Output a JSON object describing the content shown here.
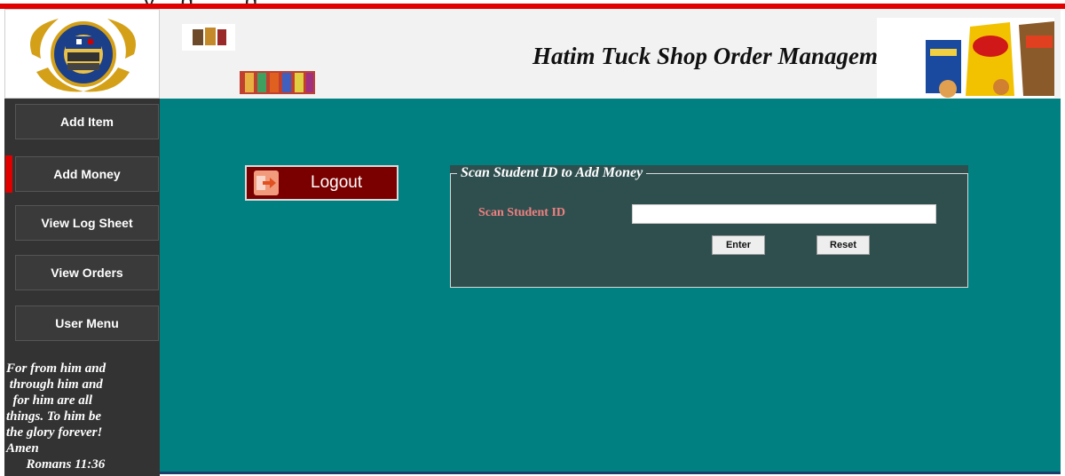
{
  "header": {
    "title": "Hatim Tuck Shop Order Management",
    "top_partial_text": "...y  ...g ... ...g ..."
  },
  "sidebar": {
    "items": [
      {
        "label": "Add Item"
      },
      {
        "label": "Add Money"
      },
      {
        "label": "View Log Sheet"
      },
      {
        "label": "View Orders"
      },
      {
        "label": "User Menu"
      }
    ],
    "verse": "For from him and\n through him and\n  for him are all\nthings. To him be\nthe glory forever!\nAmen\n      Romans 11:36"
  },
  "main": {
    "logout_label": "Logout",
    "panel": {
      "legend": "Scan Student ID to Add Money",
      "scan_label": "Scan Student ID",
      "scan_value": "",
      "enter_label": "Enter",
      "reset_label": "Reset"
    }
  },
  "colors": {
    "accent_red": "#e00000",
    "teal": "#008080",
    "panel": "#2f4f4f",
    "logout_bg": "#7a0000",
    "label_pink": "#f08080"
  },
  "icons": {
    "logo": "school-crest-icon",
    "logout": "exit-arrow-icon"
  }
}
